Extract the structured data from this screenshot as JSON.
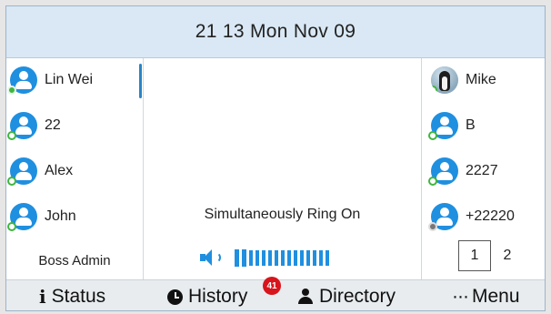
{
  "header": {
    "datetime": "21 13 Mon Nov 09"
  },
  "left_lines": [
    {
      "label": "Lin Wei",
      "icon": "contact-avatar-icon",
      "presence": "online"
    },
    {
      "label": "22",
      "icon": "contact-avatar-icon",
      "presence": "available"
    },
    {
      "label": "Alex",
      "icon": "contact-avatar-icon",
      "presence": "available"
    },
    {
      "label": "John",
      "icon": "contact-avatar-icon",
      "presence": "available"
    }
  ],
  "boss_label": "Boss Admin",
  "right_lines": [
    {
      "label": "Mike",
      "icon": "penguin-photo-avatar",
      "presence": "available"
    },
    {
      "label": "B",
      "icon": "contact-avatar-icon",
      "presence": "available"
    },
    {
      "label": "2227",
      "icon": "contact-avatar-icon",
      "presence": "available"
    },
    {
      "label": "+22220",
      "icon": "contact-avatar-icon",
      "presence": "offline"
    }
  ],
  "center": {
    "status_text": "Simultaneously Ring On",
    "volume": {
      "icon": "speaker-icon",
      "level": 1.0,
      "bar_count": 15
    }
  },
  "pager": {
    "pages": [
      "1",
      "2"
    ],
    "current": "1"
  },
  "softkeys": {
    "status": {
      "label": "Status",
      "icon": "info-icon",
      "glyph": "i"
    },
    "history": {
      "label": "History",
      "icon": "clock-icon",
      "badge": "41"
    },
    "directory": {
      "label": "Directory",
      "icon": "person-icon"
    },
    "menu": {
      "label": "Menu",
      "icon": "dots-icon",
      "glyph": "···"
    }
  },
  "colors": {
    "accent": "#1f8fe0",
    "header_bg": "#d9e8f4",
    "badge": "#d8141c",
    "presence_online": "#3fb53f",
    "presence_offline": "#777777"
  }
}
